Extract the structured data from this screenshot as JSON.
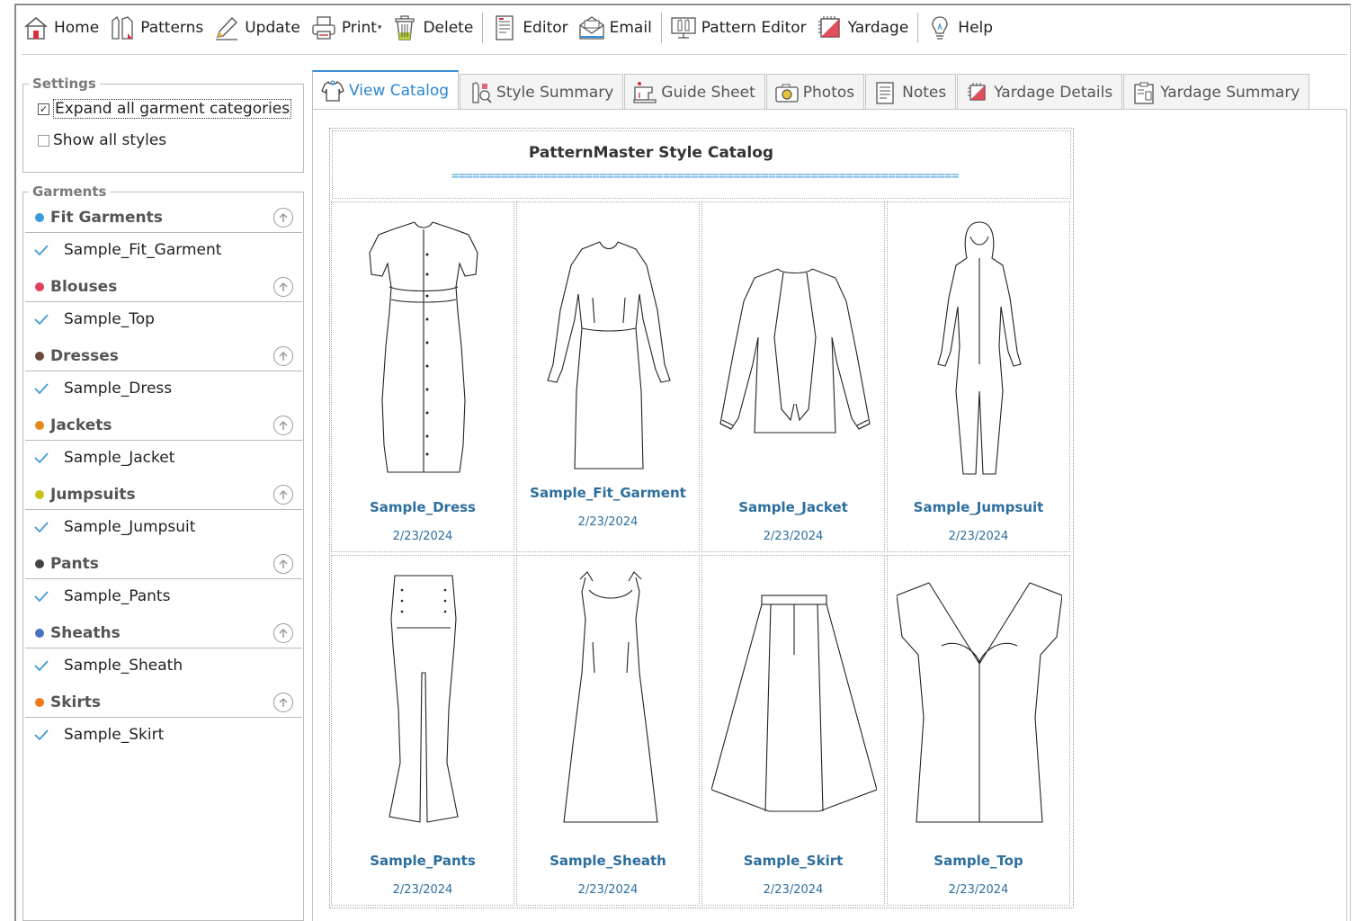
{
  "toolbar": {
    "home": "Home",
    "patterns": "Patterns",
    "update": "Update",
    "print": "Print",
    "delete": "Delete",
    "editor": "Editor",
    "email": "Email",
    "pattern_editor": "Pattern Editor",
    "yardage": "Yardage",
    "help": "Help"
  },
  "settings": {
    "legend": "Settings",
    "expand_all": "Expand all garment categories",
    "expand_all_checked": true,
    "show_all_styles": "Show all styles",
    "show_all_checked": false
  },
  "garments": {
    "legend": "Garments",
    "categories": [
      {
        "name": "Fit Garments",
        "color": "#3a9ad9",
        "items": [
          "Sample_Fit_Garment"
        ]
      },
      {
        "name": "Blouses",
        "color": "#e0405a",
        "items": [
          "Sample_Top"
        ]
      },
      {
        "name": "Dresses",
        "color": "#6b4a3a",
        "items": [
          "Sample_Dress"
        ]
      },
      {
        "name": "Jackets",
        "color": "#e8861e",
        "items": [
          "Sample_Jacket"
        ]
      },
      {
        "name": "Jumpsuits",
        "color": "#c6c21a",
        "items": [
          "Sample_Jumpsuit"
        ]
      },
      {
        "name": "Pants",
        "color": "#444444",
        "items": [
          "Sample_Pants"
        ]
      },
      {
        "name": "Sheaths",
        "color": "#4a72c0",
        "items": [
          "Sample_Sheath"
        ]
      },
      {
        "name": "Skirts",
        "color": "#ef7a1a",
        "items": [
          "Sample_Skirt"
        ]
      }
    ]
  },
  "tabs": [
    {
      "label": "View Catalog",
      "active": true
    },
    {
      "label": "Style Summary"
    },
    {
      "label": "Guide Sheet"
    },
    {
      "label": "Photos"
    },
    {
      "label": "Notes"
    },
    {
      "label": "Yardage Details"
    },
    {
      "label": "Yardage Summary"
    }
  ],
  "catalog": {
    "title": "PatternMaster Style Catalog",
    "rule": "=======================================================================================",
    "styles": [
      {
        "name": "Sample_Dress",
        "date": "2/23/2024"
      },
      {
        "name": "Sample_Fit_Garment",
        "date": "2/23/2024"
      },
      {
        "name": "Sample_Jacket",
        "date": "2/23/2024"
      },
      {
        "name": "Sample_Jumpsuit",
        "date": "2/23/2024"
      },
      {
        "name": "Sample_Pants",
        "date": "2/23/2024"
      },
      {
        "name": "Sample_Sheath",
        "date": "2/23/2024"
      },
      {
        "name": "Sample_Skirt",
        "date": "2/23/2024"
      },
      {
        "name": "Sample_Top",
        "date": "2/23/2024"
      }
    ]
  },
  "colors": {
    "accent": "#2a86cf",
    "link": "#2c6e9e",
    "check": "#3d9ad6"
  }
}
